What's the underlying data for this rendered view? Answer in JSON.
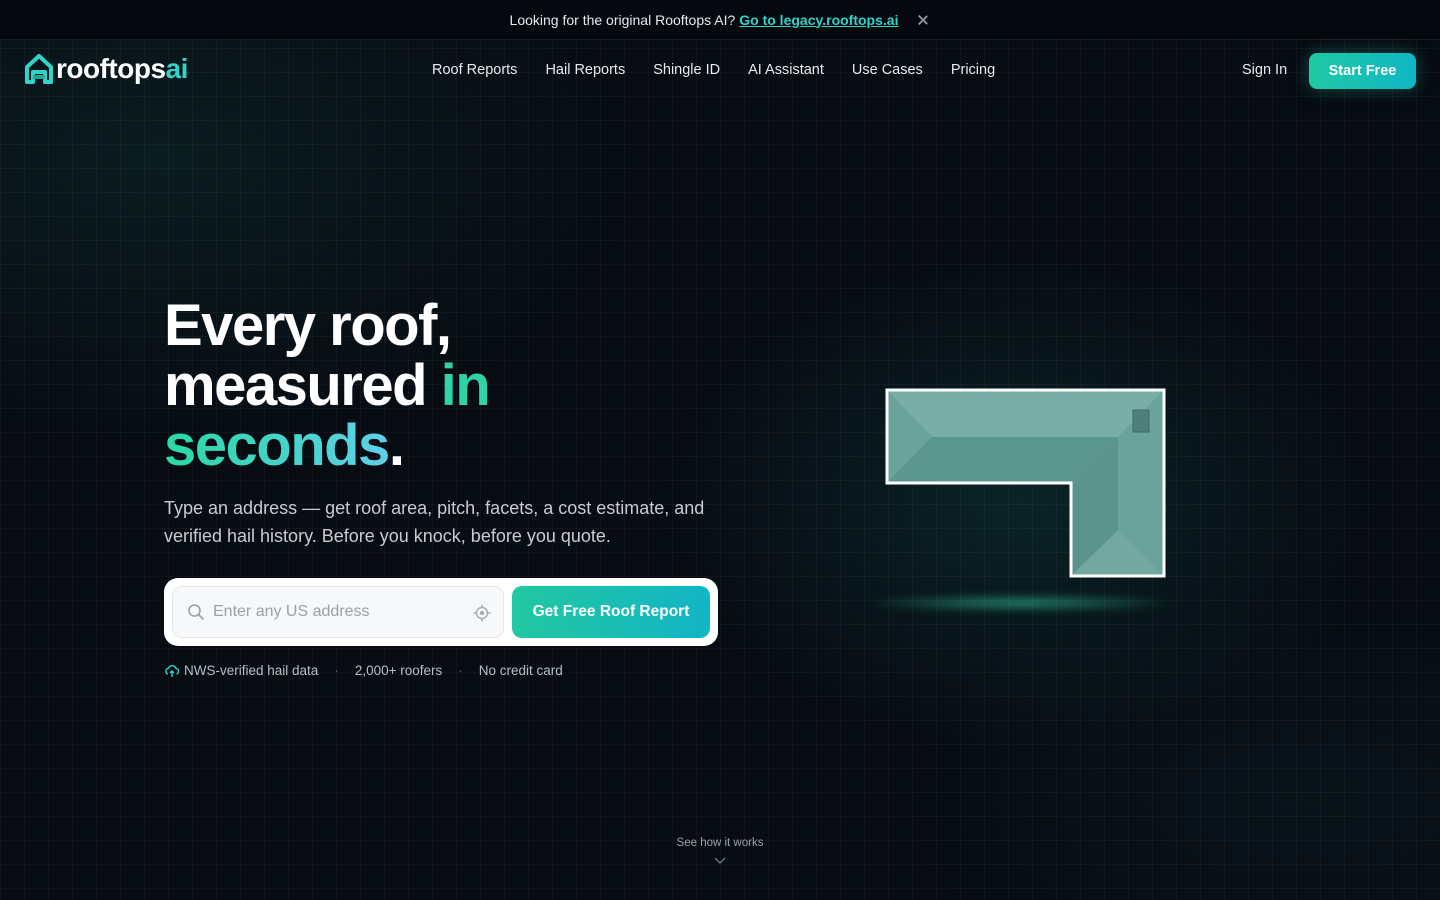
{
  "announcement": {
    "text": "Looking for the original Rooftops AI?",
    "link_label": "Go to legacy.rooftops.ai"
  },
  "nav": {
    "logo_main": "rooftops",
    "logo_accent": "ai",
    "links": [
      "Roof Reports",
      "Hail Reports",
      "Shingle ID",
      "AI Assistant",
      "Use Cases",
      "Pricing"
    ],
    "sign_in": "Sign In",
    "start_free": "Start Free"
  },
  "hero": {
    "line1": "Every roof,",
    "line2_a": "measured",
    "line2_b": "in",
    "line3_a": "seconds",
    "line3_b": ".",
    "subtitle": "Type an address — get roof area, pitch, facets, a cost estimate, and verified hail history. Before you knock, before you quote.",
    "search_placeholder": "Enter any US address",
    "cta_label": "Get Free Roof Report"
  },
  "trust": {
    "item1": "NWS-verified hail data",
    "item2": "2,000+ roofers",
    "item3": "No credit card",
    "separator": "·"
  },
  "footer_hint": {
    "label": "See how it works"
  },
  "colors": {
    "accent": "#2fd3c9",
    "brand_green": "#22c8a0",
    "background": "#070b12"
  }
}
